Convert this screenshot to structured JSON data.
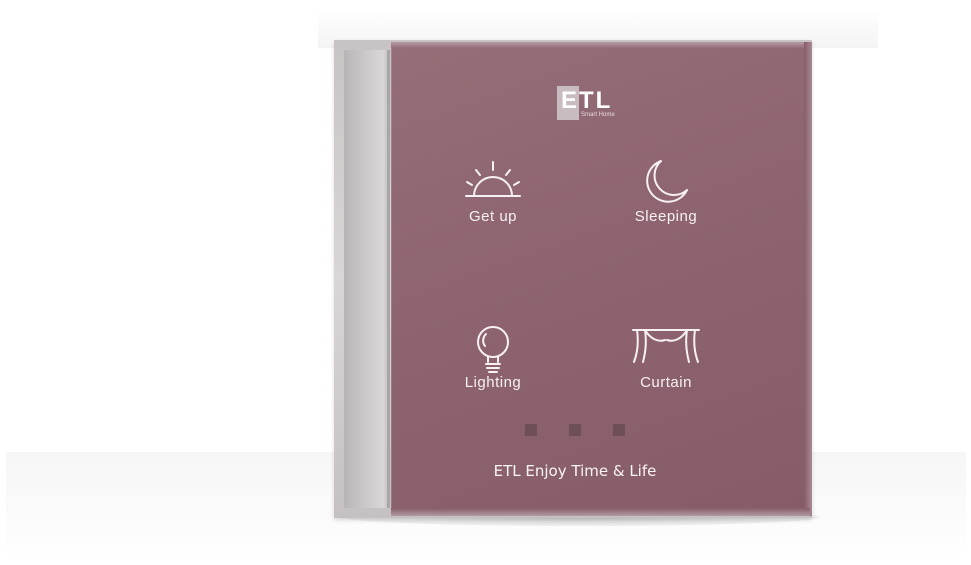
{
  "brand": {
    "logo_text": "ETL",
    "logo_subtext": "Smart Home",
    "tagline": "ETL Enjoy Time & Life"
  },
  "buttons": [
    {
      "label": "Get up",
      "icon": "sunrise-icon"
    },
    {
      "label": "Sleeping",
      "icon": "moon-icon"
    },
    {
      "label": "Lighting",
      "icon": "lightbulb-icon"
    },
    {
      "label": "Curtain",
      "icon": "curtain-icon"
    }
  ],
  "indicators": {
    "count": 3
  },
  "colors": {
    "glass": "#8d6470",
    "frame": "#c9c6c7",
    "text": "#f7f1f3"
  }
}
